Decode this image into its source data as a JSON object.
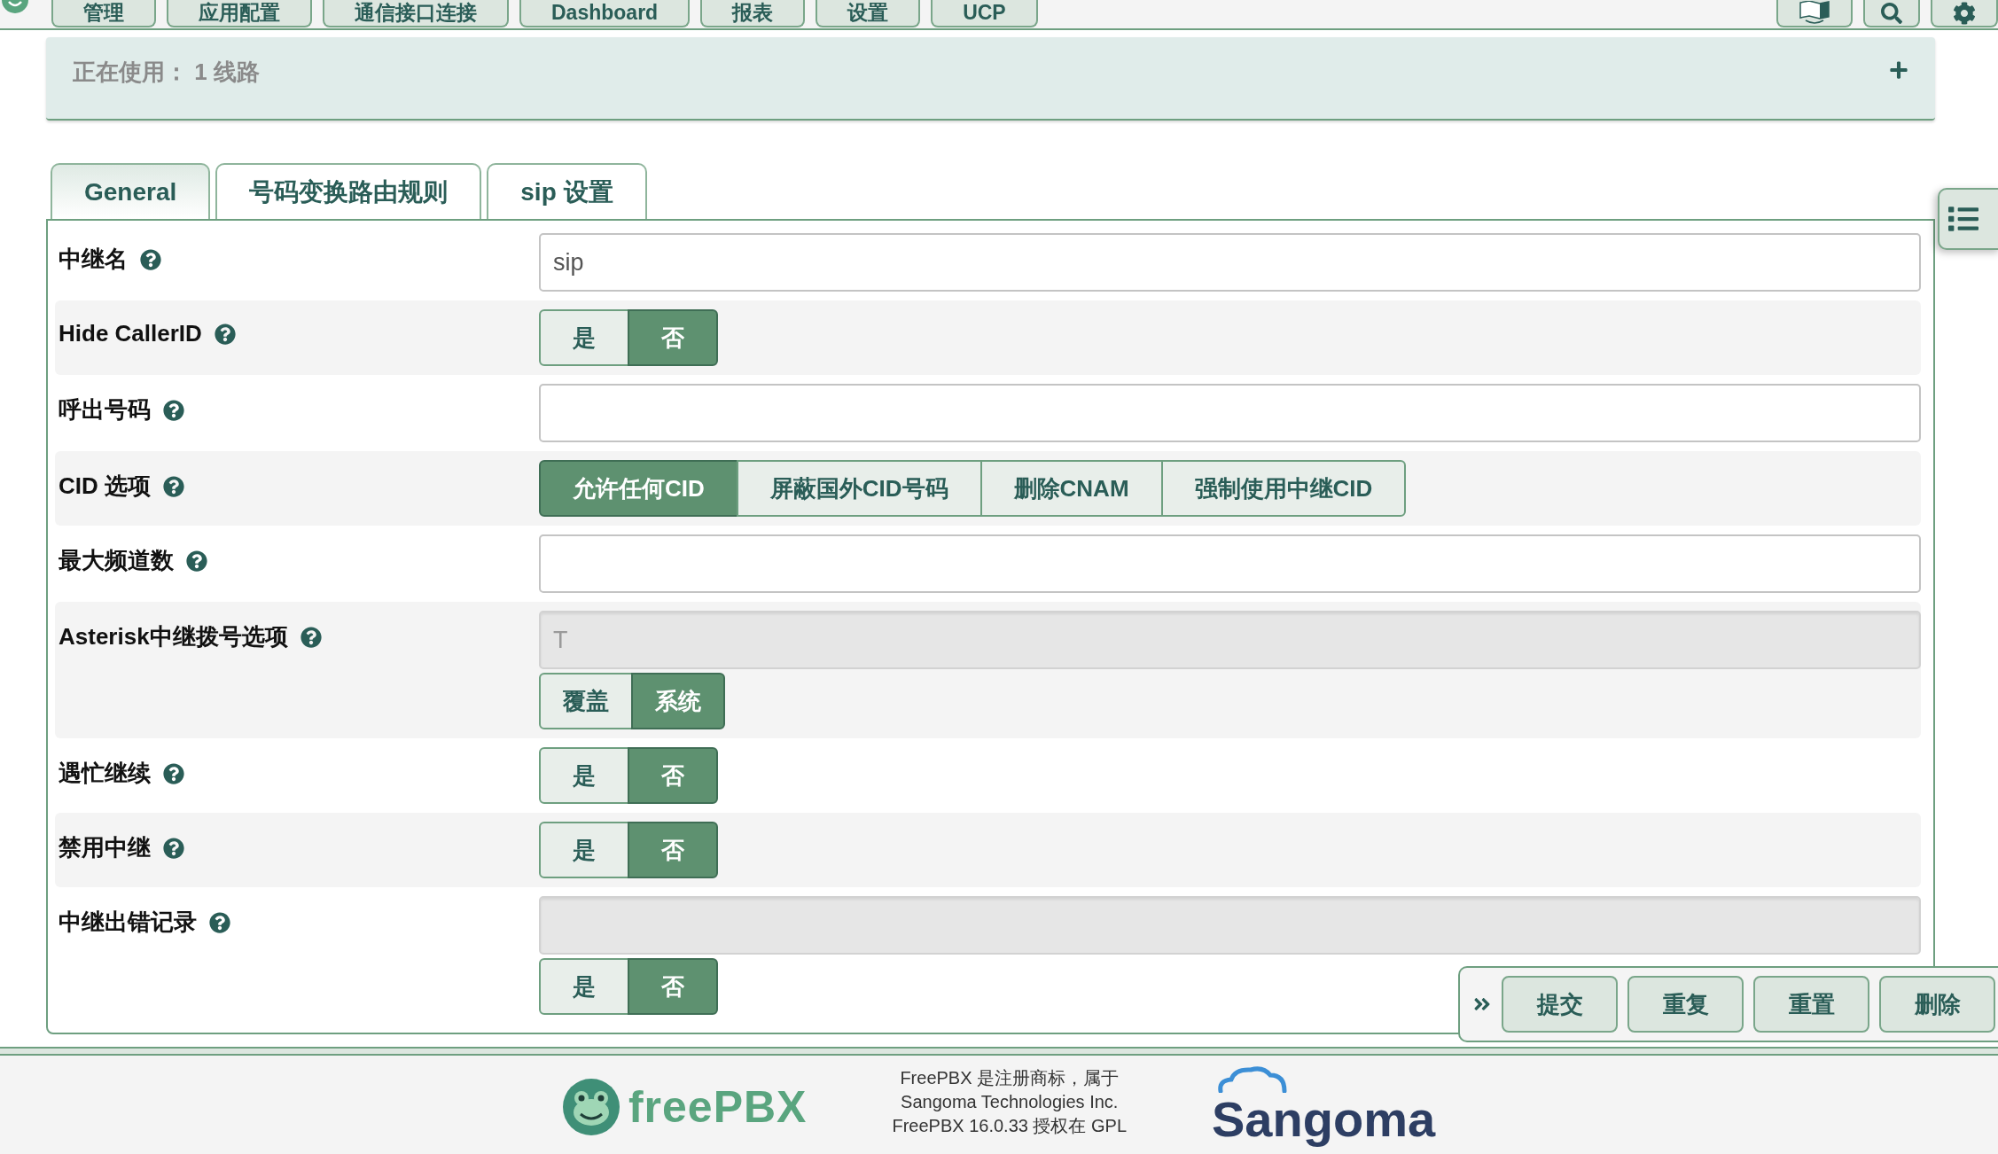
{
  "nav": {
    "items": [
      "管理",
      "应用配置",
      "通信接口连接",
      "Dashboard",
      "报表",
      "设置",
      "UCP"
    ]
  },
  "status_panel": {
    "text": "正在使用： 1 线路"
  },
  "tabs": [
    {
      "label": "General",
      "selected": true
    },
    {
      "label": "号码变换路由规则",
      "selected": false
    },
    {
      "label": "sip 设置",
      "selected": false
    }
  ],
  "fields": [
    {
      "label": "中继名",
      "kind": "input",
      "input": {
        "value": "sip",
        "disabled": false
      }
    },
    {
      "label": "Hide CallerID",
      "kind": "toggle",
      "options": [
        {
          "label": "是",
          "selected": false
        },
        {
          "label": "否",
          "selected": true
        }
      ]
    },
    {
      "label": "呼出号码",
      "kind": "input",
      "input": {
        "disabled": false
      }
    },
    {
      "label": "CID 选项",
      "kind": "toggle",
      "options": [
        {
          "label": "允许任何CID",
          "selected": true
        },
        {
          "label": "屏蔽国外CID号码",
          "selected": false
        },
        {
          "label": "删除CNAM",
          "selected": false
        },
        {
          "label": "强制使用中继CID",
          "selected": false
        }
      ]
    },
    {
      "label": "最大频道数",
      "kind": "input",
      "input": {
        "disabled": false
      }
    },
    {
      "label": "Asterisk中继拨号选项",
      "kind": "input_toggle",
      "input": {
        "value": "T",
        "disabled": true
      },
      "options": [
        {
          "label": "覆盖",
          "selected": false
        },
        {
          "label": "系统",
          "selected": true
        }
      ]
    },
    {
      "label": "遇忙继续",
      "kind": "toggle",
      "options": [
        {
          "label": "是",
          "selected": false
        },
        {
          "label": "否",
          "selected": true
        }
      ]
    },
    {
      "label": "禁用中继",
      "kind": "toggle",
      "options": [
        {
          "label": "是",
          "selected": false
        },
        {
          "label": "否",
          "selected": true
        }
      ]
    },
    {
      "label": "中继出错记录",
      "kind": "input_toggle",
      "input": {
        "disabled": true
      },
      "options": [
        {
          "label": "是",
          "selected": false
        },
        {
          "label": "否",
          "selected": true
        }
      ]
    }
  ],
  "action_bar": {
    "buttons": [
      "提交",
      "重复",
      "重置",
      "删除"
    ]
  },
  "footer": {
    "logo_text": "freePBX",
    "notice": [
      "FreePBX 是注册商标，属于",
      "Sangoma Technologies Inc.",
      "FreePBX 16.0.33 授权在 GPL"
    ],
    "partner_logo_text": "Sangoma"
  }
}
